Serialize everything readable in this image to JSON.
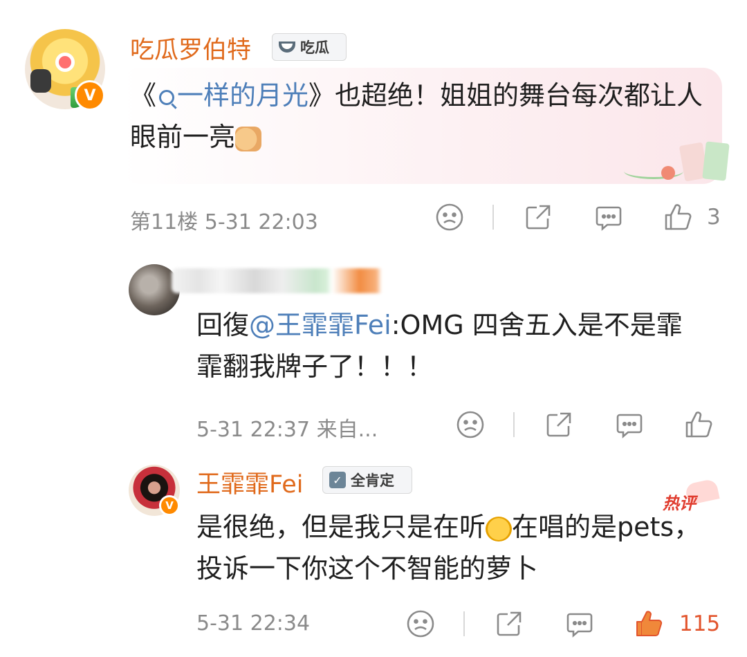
{
  "comments": [
    {
      "username": "吃瓜罗伯特",
      "badge_label": "吃瓜",
      "badge_icon": "melon-icon",
      "verified_label": "V",
      "text_before_link": "《",
      "link_text": "一样的月光",
      "text_after_link": "》也超绝！姐姐的舞台每次都让人眼前一亮",
      "emoji": "thumbs-up-emoji",
      "floor": "第11楼",
      "time": "5-31 22:03",
      "like_count": "3"
    },
    {
      "reply_prefix": "回復",
      "mention": "@王霏霏Fei",
      "text": ":OMG 四舍五入是不是霏霏翻我牌子了！！！",
      "time": "5-31 22:37",
      "source": "来自..."
    },
    {
      "username": "王霏霏Fei",
      "badge_label": "全肯定",
      "badge_icon": "calendar-check-icon",
      "verified_label": "V",
      "hot_label": "热评",
      "text_part1": "是很绝，但是我只是在听",
      "emoji": "face-covering-emoji",
      "text_part2": "在唱的是pets，投诉一下你这个不智能的萝卜",
      "time": "5-31 22:34",
      "like_count": "115"
    }
  ],
  "colors": {
    "username": "#e06a1c",
    "link": "#4e7fb9",
    "meta": "#8a8a8a",
    "hot_like": "#e2542c"
  }
}
